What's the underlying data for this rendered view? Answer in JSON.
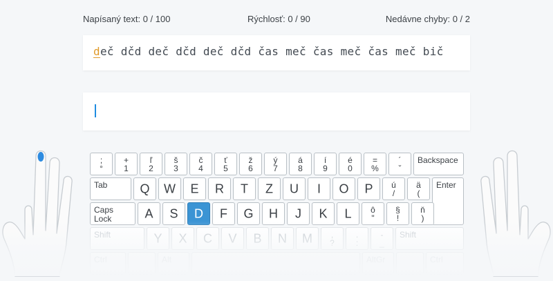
{
  "stats": {
    "typed": "Napísaný text: 0 / 100",
    "speed": "Rýchlosť: 0 / 90",
    "errors": "Nedávne chyby: 0 / 2"
  },
  "text": {
    "current_char": "d",
    "remaining": "eč dčd deč dčd deč dčd čas meč čas meč čas meč bič"
  },
  "keyboard": {
    "active_key": "D",
    "number_row": [
      {
        "top": ";",
        "bottom": "°"
      },
      {
        "top": "+",
        "bottom": "1"
      },
      {
        "top": "ľ",
        "bottom": "2"
      },
      {
        "top": "š",
        "bottom": "3"
      },
      {
        "top": "č",
        "bottom": "4"
      },
      {
        "top": "ť",
        "bottom": "5"
      },
      {
        "top": "ž",
        "bottom": "6"
      },
      {
        "top": "ý",
        "bottom": "7"
      },
      {
        "top": "á",
        "bottom": "8"
      },
      {
        "top": "í",
        "bottom": "9"
      },
      {
        "top": "é",
        "bottom": "0"
      },
      {
        "top": "=",
        "bottom": "%"
      },
      {
        "top": "´",
        "bottom": "ˇ"
      }
    ],
    "backspace": "Backspace",
    "tab": "Tab",
    "row_q": [
      "Q",
      "W",
      "E",
      "R",
      "T",
      "Z",
      "U",
      "I",
      "O",
      "P"
    ],
    "row_q_extra": [
      {
        "top": "ú",
        "bottom": "/"
      },
      {
        "top": "ä",
        "bottom": "("
      }
    ],
    "enter": "Enter",
    "caps_line1": "Caps",
    "caps_line2": "Lock",
    "row_a": [
      "A",
      "S",
      "D",
      "F",
      "G",
      "H",
      "J",
      "K",
      "L"
    ],
    "row_a_extra": [
      {
        "top": "ô",
        "bottom": "\""
      },
      {
        "top": "§",
        "bottom": "!"
      },
      {
        "top": "ň",
        "bottom": ")"
      }
    ],
    "shift": "Shift",
    "row_y": [
      "Y",
      "X",
      "C",
      "V",
      "B",
      "N",
      "M"
    ],
    "row_y_extra": [
      {
        "top": ",",
        "bottom": "?"
      },
      {
        "top": ".",
        "bottom": ":"
      },
      {
        "top": "-",
        "bottom": "_"
      }
    ],
    "ctrl": "Ctrl",
    "alt": "Alt",
    "altgr": "AltGr"
  },
  "colors": {
    "accent": "#3b94d4",
    "current_char": "#e09a2a",
    "caret": "#1f8ce0",
    "finger_highlight": "#2d8be0"
  }
}
